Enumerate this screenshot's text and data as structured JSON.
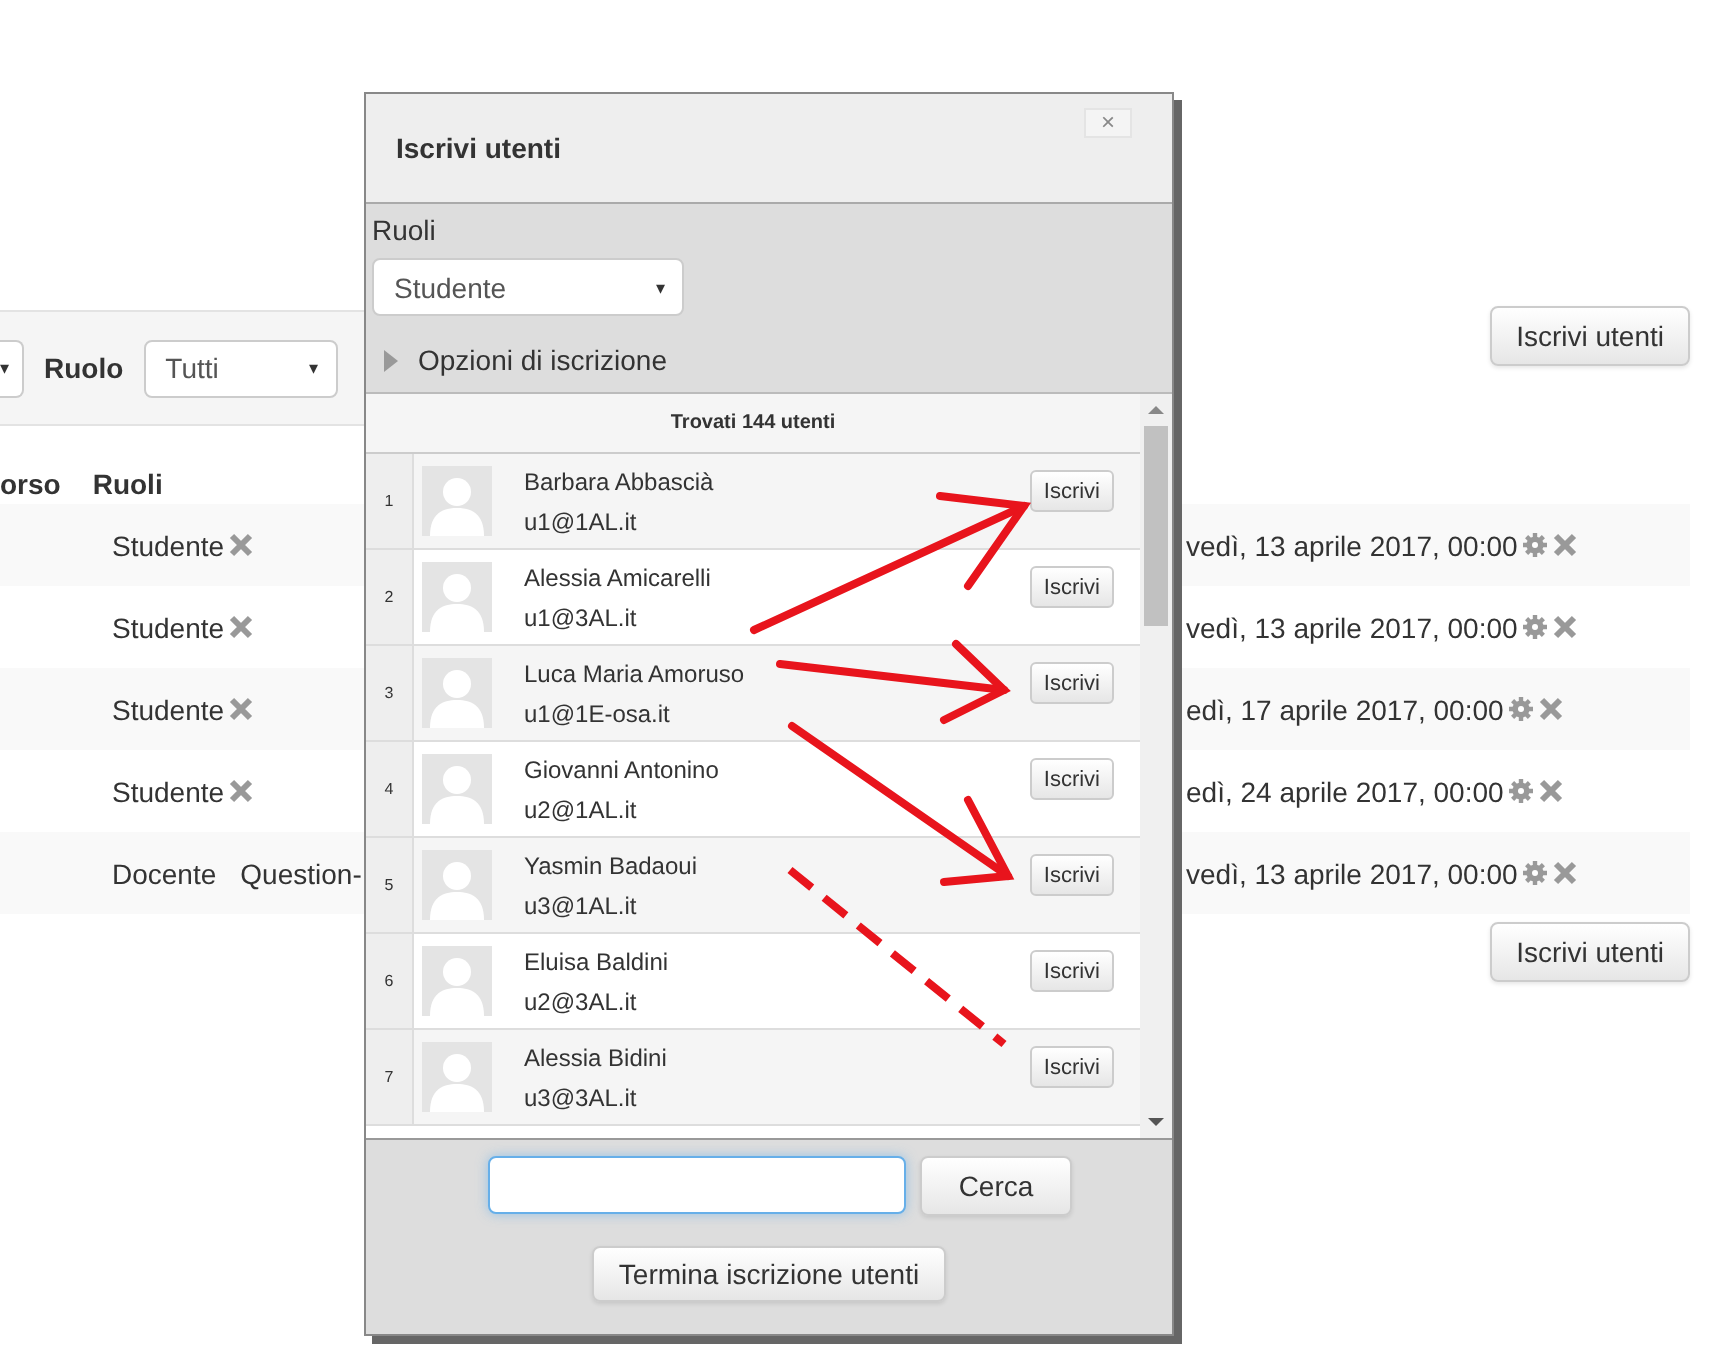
{
  "background": {
    "filter": {
      "select_1": "▾",
      "role_label": "Ruolo",
      "role_select": "Tutti",
      "caret": "▾"
    },
    "columns": [
      "orso",
      "Ruoli"
    ],
    "rows": [
      {
        "roles": [
          "Studente"
        ],
        "removable": true,
        "date": "vedì, 13 aprile 2017, 00:00"
      },
      {
        "roles": [
          "Studente"
        ],
        "removable": true,
        "date": "vedì, 13 aprile 2017, 00:00"
      },
      {
        "roles": [
          "Studente"
        ],
        "removable": true,
        "date": "edì, 17 aprile 2017, 00:00"
      },
      {
        "roles": [
          "Studente"
        ],
        "removable": true,
        "date": "edì, 24 aprile 2017, 00:00"
      },
      {
        "roles": [
          "Docente",
          "Question-"
        ],
        "removable": false,
        "date": "vedì, 13 aprile 2017, 00:00"
      }
    ],
    "buttons": [
      "Iscrivi utenti",
      "Iscrivi utenti"
    ]
  },
  "dialog": {
    "title": "Iscrivi utenti",
    "close": "×",
    "roles_label": "Ruoli",
    "role_select": "Studente",
    "select_caret": "▾",
    "options_toggle": {
      "label": "Opzioni di iscrizione",
      "expanded": false
    },
    "found": "Trovati 144 utenti",
    "users": [
      {
        "number": "1",
        "name": "Barbara Abbascià",
        "email": "u1@1AL.it",
        "action": "Iscrivi"
      },
      {
        "number": "2",
        "name": "Alessia Amicarelli",
        "email": "u1@3AL.it",
        "action": "Iscrivi"
      },
      {
        "number": "3",
        "name": "Luca Maria Amoruso",
        "email": "u1@1E-osa.it",
        "action": "Iscrivi"
      },
      {
        "number": "4",
        "name": "Giovanni Antonino",
        "email": "u2@1AL.it",
        "action": "Iscrivi"
      },
      {
        "number": "5",
        "name": "Yasmin Badaoui",
        "email": "u3@1AL.it",
        "action": "Iscrivi"
      },
      {
        "number": "6",
        "name": "Eluisa Baldini",
        "email": "u2@3AL.it",
        "action": "Iscrivi"
      },
      {
        "number": "7",
        "name": "Alessia Bidini",
        "email": "u3@3AL.it",
        "action": "Iscrivi"
      }
    ],
    "search_button": "Cerca",
    "finish_button": "Termina iscrizione utenti"
  }
}
